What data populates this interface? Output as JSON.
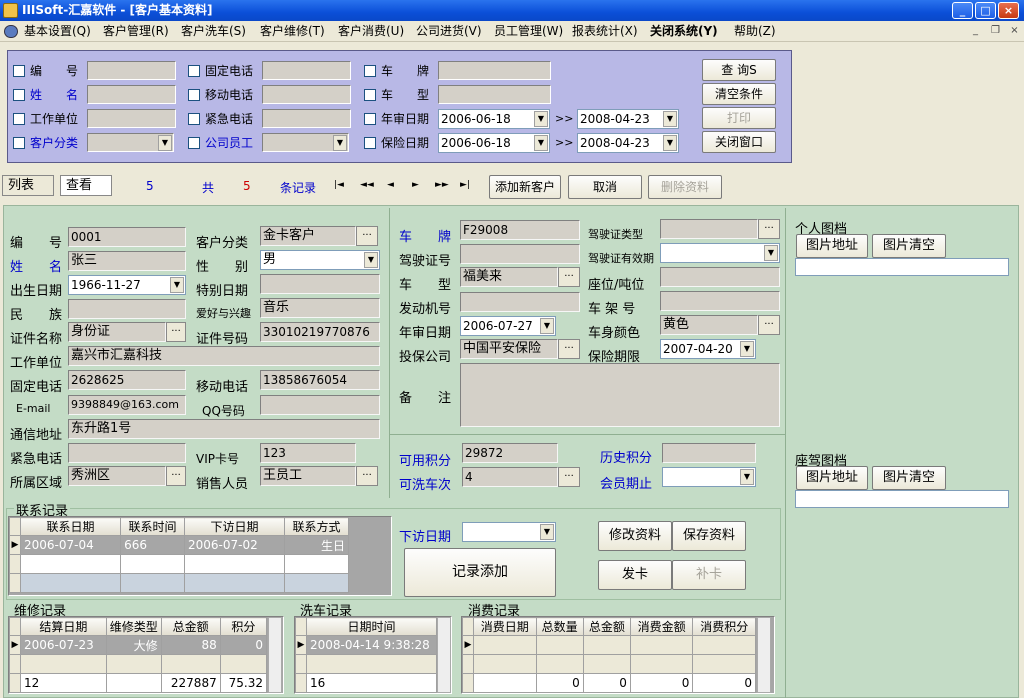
{
  "window": {
    "title": "IIISoft-汇嘉软件 - [客户基本资料]"
  },
  "menu": [
    "基本设置(Q)",
    "客户管理(R)",
    "客户洗车(S)",
    "客户维修(T)",
    "客户消费(U)",
    "公司进货(V)",
    "员工管理(W)",
    "报表统计(X)",
    "关闭系统(Y)",
    "帮助(Z)"
  ],
  "query": {
    "labels": {
      "id": "编　　号",
      "name": "姓　　名",
      "company": "工作单位",
      "category": "客户分类",
      "landline": "固定电话",
      "mobile": "移动电话",
      "emergency": "紧急电话",
      "staff": "公司员工",
      "plate": "车　　牌",
      "model": "车　　型",
      "inspect": "年审日期",
      "insure": "保险日期"
    },
    "inspect_from": "2006-06-18",
    "inspect_to": "2008-04-23",
    "insure_from": "2006-06-18",
    "insure_to": "2008-04-23",
    "range_sep": ">>",
    "buttons": {
      "search": "查 询S",
      "clear": "清空条件",
      "print": "打印",
      "close": "关闭窗口"
    }
  },
  "toolbar": {
    "tab_list": "列表",
    "tab_view": "查看",
    "current": "5",
    "total_label": "共",
    "total": "5",
    "records_label": "条记录",
    "nav": [
      "|◄",
      "◄◄",
      "◄",
      "►",
      "►►",
      "►|"
    ],
    "add": "添加新客户",
    "cancel": "取消",
    "delete": "删除资料"
  },
  "customer": {
    "labels": {
      "id": "编　　号",
      "name": "姓　　名",
      "birthday": "出生日期",
      "ethnic": "民　　族",
      "idtype": "证件名称",
      "work": "工作单位",
      "landline": "固定电话",
      "email": "E-mail",
      "addr": "通信地址",
      "emerg": "紧急电话",
      "district": "所属区域",
      "category": "客户分类",
      "gender": "性　　别",
      "special": "特别日期",
      "hobby": "爱好与兴趣",
      "idno": "证件号码",
      "mobile": "移动电话",
      "qq": "QQ号码",
      "vip": "VIP卡号",
      "seller": "销售人员"
    },
    "id": "0001",
    "name": "张三",
    "birthday": "1966-11-27",
    "ethnic": "",
    "idtype": "身份证",
    "work": "嘉兴市汇嘉科技",
    "landline": "2628625",
    "email": "9398849@163.com",
    "addr": "东升路1号",
    "emerg": "",
    "district": "秀洲区",
    "category": "金卡客户",
    "gender": "男",
    "special": "",
    "hobby": "音乐",
    "idno": "33010219770876",
    "mobile": "13858676054",
    "qq": "",
    "vip": "123",
    "seller": "王员工"
  },
  "vehicle": {
    "labels": {
      "plate": "车　　牌",
      "license": "驾驶证号",
      "model": "车　　型",
      "engine": "发动机号",
      "inspect": "年审日期",
      "insurer": "投保公司",
      "remark": "备　　注",
      "ltype": "驾驶证类型",
      "lexp": "驾驶证有效期",
      "seat": "座位/吨位",
      "frame": "车 架 号",
      "color": "车身颜色",
      "insexp": "保险期限"
    },
    "plate": "F29008",
    "license": "",
    "model": "福美来",
    "engine": "",
    "inspect": "2006-07-27",
    "insurer": "中国平安保险",
    "ltype": "",
    "lexp": "",
    "seat": "",
    "frame": "",
    "color": "黄色",
    "insexp": "2007-04-20",
    "remark": ""
  },
  "points": {
    "labels": {
      "avail": "可用积分",
      "wash": "可洗车次",
      "hist": "历史积分",
      "expire": "会员期止"
    },
    "avail": "29872",
    "wash": "4",
    "hist": "",
    "expire": ""
  },
  "personal_pic": {
    "title": "个人图档",
    "addr_btn": "图片地址",
    "clear_btn": "图片清空"
  },
  "seat_pic": {
    "title": "座驾图档",
    "addr_btn": "图片地址",
    "clear_btn": "图片清空"
  },
  "contact": {
    "title": "联系记录",
    "headers": [
      "联系日期",
      "联系时间",
      "下访日期",
      "联系方式"
    ],
    "row": [
      "2006-07-04",
      "666",
      "2006-07-02",
      "生日"
    ]
  },
  "revisit": {
    "label": "下访日期",
    "value": ""
  },
  "actions": {
    "edit": "修改资料",
    "save": "保存资料",
    "add_record": "记录添加",
    "issue": "发卡",
    "reissue": "补卡"
  },
  "repair": {
    "title": "维修记录",
    "headers": [
      "结算日期",
      "维修类型",
      "总金额",
      "积分"
    ],
    "row": [
      "2006-07-23",
      "大修",
      "88",
      "0"
    ],
    "total": [
      "12",
      "",
      "227887",
      "75.32"
    ]
  },
  "wash": {
    "title": "洗车记录",
    "headers": [
      "日期时间"
    ],
    "row": [
      "2008-04-14 9:38:28"
    ],
    "total": [
      "16"
    ]
  },
  "consume": {
    "title": "消费记录",
    "headers": [
      "消费日期",
      "总数量",
      "总金额",
      "消费金额",
      "消费积分"
    ],
    "total": [
      "",
      "0",
      "0",
      "0",
      "0"
    ]
  }
}
